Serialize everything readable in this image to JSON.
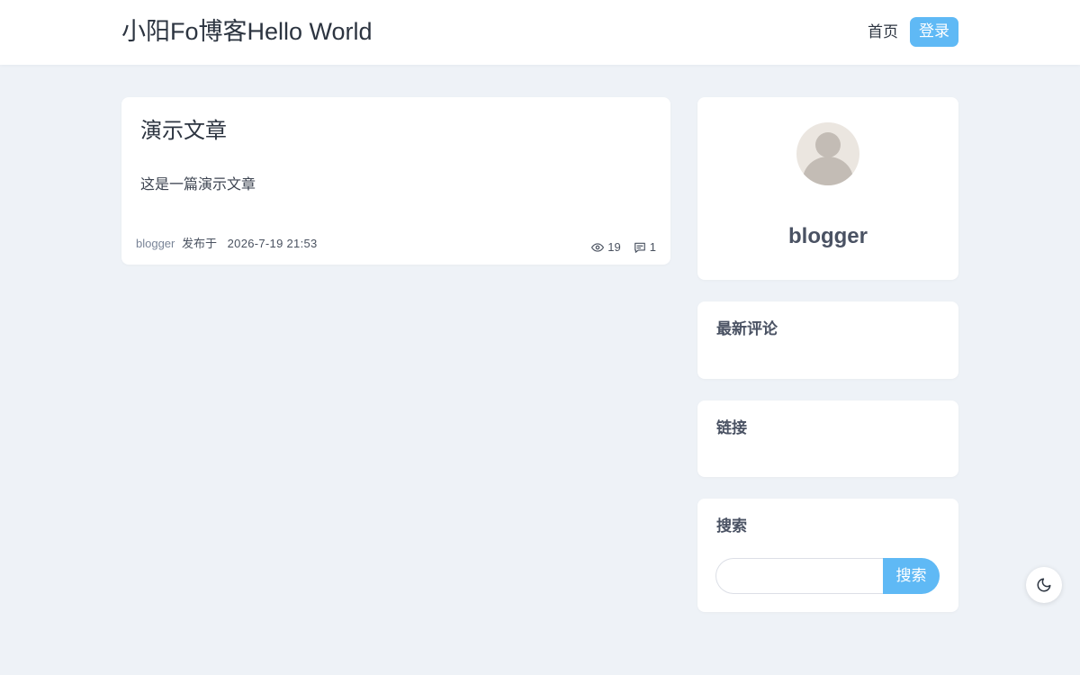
{
  "header": {
    "site_title": "小阳Fo博客Hello World",
    "nav_home": "首页",
    "login_label": "登录"
  },
  "post": {
    "title": "演示文章",
    "summary": "这是一篇演示文章",
    "author": "blogger",
    "published_label": "发布于",
    "date": "2026-7-19 21:53",
    "views": "19",
    "comments": "1",
    "views_icon": "eye-icon",
    "comments_icon": "comment-icon"
  },
  "profile": {
    "name": "blogger",
    "avatar_icon": "user-avatar-icon"
  },
  "widgets": {
    "recent_comments_title": "最新评论",
    "links_title": "链接",
    "search_title": "搜索",
    "search_placeholder": "",
    "search_button": "搜索"
  },
  "theme_toggle_icon": "moon-icon",
  "colors": {
    "accent": "#5fb9f5",
    "background": "#eef2f7",
    "card": "#ffffff"
  }
}
